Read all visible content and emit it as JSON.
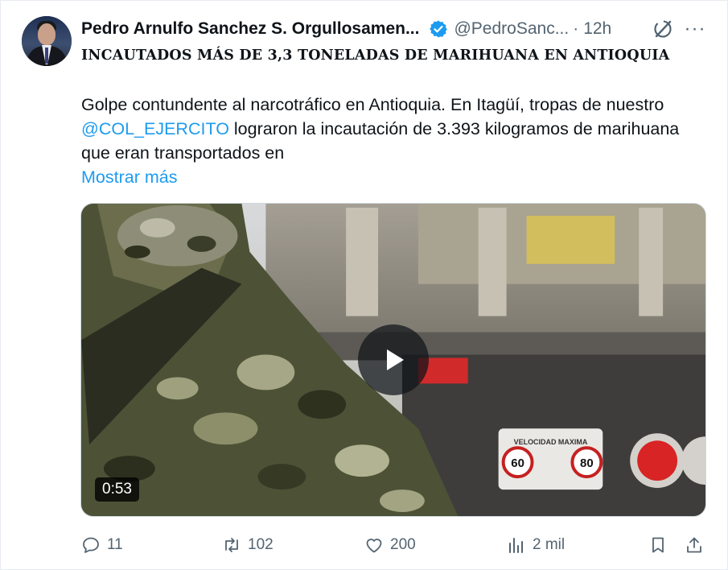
{
  "tweet": {
    "author_name": "Pedro Arnulfo Sanchez S. Orgullosamen...",
    "handle": "@PedroSanc...",
    "separator": "·",
    "time": "12h",
    "headline": "INCAUTADOS MÁS DE 3,3 TONELADAS DE MARIHUANA EN ANTIOQUIA",
    "body_part1": "Golpe contundente al narcotráfico en Antioquia. En Itagüí, tropas de nuestro ",
    "mention": "@COL_EJERCITO",
    "body_part2": " lograron la incautación de 3.393 kilogramos de marihuana que eran transportados en",
    "show_more": "Mostrar más",
    "more_menu": "···"
  },
  "media": {
    "duration": "0:53",
    "plate_text": "VELOCIDAD MAXIMA",
    "speed_1": "60",
    "speed_2": "80"
  },
  "actions": {
    "replies": "11",
    "reposts": "102",
    "likes": "200",
    "views": "2 mil"
  },
  "icons": {
    "verified": "verified-badge-icon",
    "grok": "grok-icon",
    "more": "more-icon",
    "reply": "reply-icon",
    "repost": "repost-icon",
    "like": "heart-icon",
    "views": "views-icon",
    "bookmark": "bookmark-icon",
    "share": "share-icon"
  },
  "colors": {
    "accent": "#1d9bf0",
    "muted": "#536471",
    "text": "#0f1419"
  }
}
